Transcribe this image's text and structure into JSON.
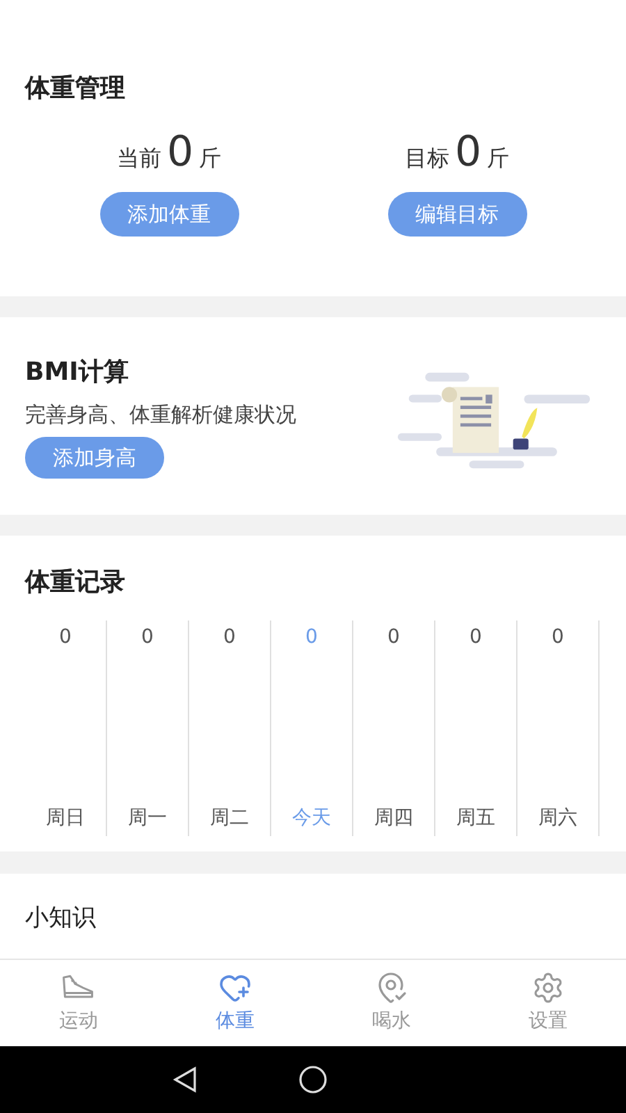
{
  "weight_management": {
    "title": "体重管理",
    "stats": [
      {
        "label": "当前",
        "value": "0",
        "unit": "斤",
        "button": "添加体重"
      },
      {
        "label": "目标",
        "value": "0",
        "unit": "斤",
        "button": "编辑目标"
      }
    ]
  },
  "bmi": {
    "title": "BMI计算",
    "description": "完善身高、体重解析健康状况",
    "button": "添加身高"
  },
  "weight_record": {
    "title": "体重记录",
    "days": [
      {
        "value": "0",
        "label": "周日",
        "selected": false
      },
      {
        "value": "0",
        "label": "周一",
        "selected": false
      },
      {
        "value": "0",
        "label": "周二",
        "selected": false
      },
      {
        "value": "0",
        "label": "今天",
        "selected": true
      },
      {
        "value": "0",
        "label": "周四",
        "selected": false
      },
      {
        "value": "0",
        "label": "周五",
        "selected": false
      },
      {
        "value": "0",
        "label": "周六",
        "selected": false
      }
    ]
  },
  "knowledge": {
    "title": "小知识"
  },
  "tab_bar": [
    {
      "kind": "sport",
      "label": "运动",
      "selected": false
    },
    {
      "kind": "weight",
      "label": "体重",
      "selected": true
    },
    {
      "kind": "water",
      "label": "喝水",
      "selected": false
    },
    {
      "kind": "settings",
      "label": "设置",
      "selected": false
    }
  ]
}
